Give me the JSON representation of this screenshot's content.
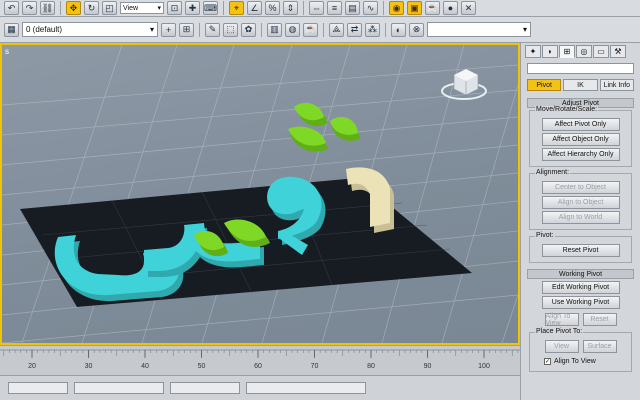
{
  "toolbar": {
    "view_dropdown": "View",
    "layer_dropdown": "0 (default)",
    "selection_set": ""
  },
  "viewport": {
    "label": "s"
  },
  "ruler": {
    "ticks": [
      {
        "label": "20",
        "value": 20
      },
      {
        "label": "30",
        "value": 30
      },
      {
        "label": "40",
        "value": 40
      },
      {
        "label": "50",
        "value": 50
      },
      {
        "label": "60",
        "value": 60
      },
      {
        "label": "70",
        "value": 70
      },
      {
        "label": "80",
        "value": 80
      },
      {
        "label": "90",
        "value": 90
      },
      {
        "label": "100",
        "value": 100
      }
    ]
  },
  "command_panel": {
    "tabs": [
      {
        "icon": "create-icon"
      },
      {
        "icon": "modify-icon"
      },
      {
        "icon": "hierarchy-icon"
      },
      {
        "icon": "motion-icon"
      },
      {
        "icon": "display-icon"
      },
      {
        "icon": "utilities-icon"
      }
    ],
    "hierarchy_tabs": [
      "Pivot",
      "IK",
      "Link Info"
    ],
    "adjust_pivot": {
      "title": "Adjust Pivot",
      "move_group": "Move/Rotate/Scale:",
      "affect_pivot": "Affect Pivot Only",
      "affect_object": "Affect Object Only",
      "affect_hierarchy": "Affect Hierarchy Only",
      "alignment_group": "Alignment:",
      "center_to_object": "Center to Object",
      "align_to_object": "Align to Object",
      "align_to_world": "Align to World",
      "pivot_group": "Pivot:",
      "reset_pivot": "Reset Pivot"
    },
    "working_pivot": {
      "title": "Working Pivot",
      "edit_working_pivot": "Edit Working Pivot",
      "use_working_pivot": "Use Working Pivot",
      "align_to_view": "Align To View",
      "reset": "Reset",
      "place_group": "Place Pivot To:",
      "view": "View",
      "surface": "Surface",
      "align_to_view_check": "Align To View"
    }
  },
  "colors": {
    "active_viewport_border": "#f0c400",
    "cyan_letters": "#3fd2d8",
    "green_dots": "#6ec81e",
    "cream_letter": "#ece2b8",
    "dark_plane": "#171c22"
  }
}
